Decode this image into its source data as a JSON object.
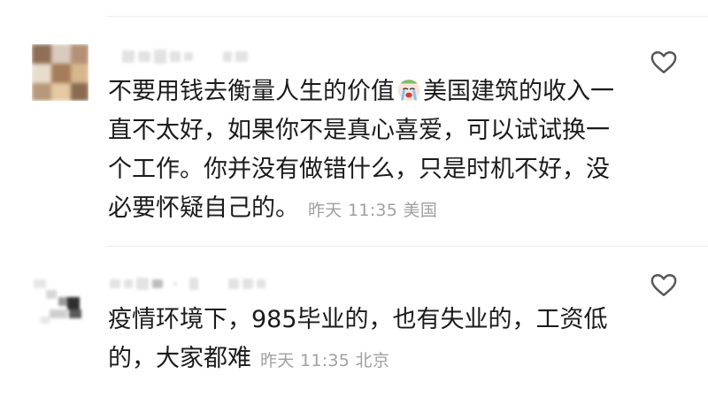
{
  "comments": [
    {
      "text_lines": [
        "不要用钱去衡量人生的价值",
        "美国建筑的收入一",
        "直不太好，如果你不是真心喜爱，可以试试换一",
        "个工作。你并没有做错什么，只是时机不好，没",
        "必要怀疑自己的。"
      ],
      "time": "昨天 11:35",
      "location": "美国",
      "emoji": "crying-face-emoji",
      "like_icon": "heart-outline-icon"
    },
    {
      "text_lines": [
        "疫情环境下，985毕业的，也有失业的，工资低",
        "的，大家都难"
      ],
      "time": "昨天 11:35",
      "location": "北京",
      "like_icon": "heart-outline-icon"
    }
  ]
}
